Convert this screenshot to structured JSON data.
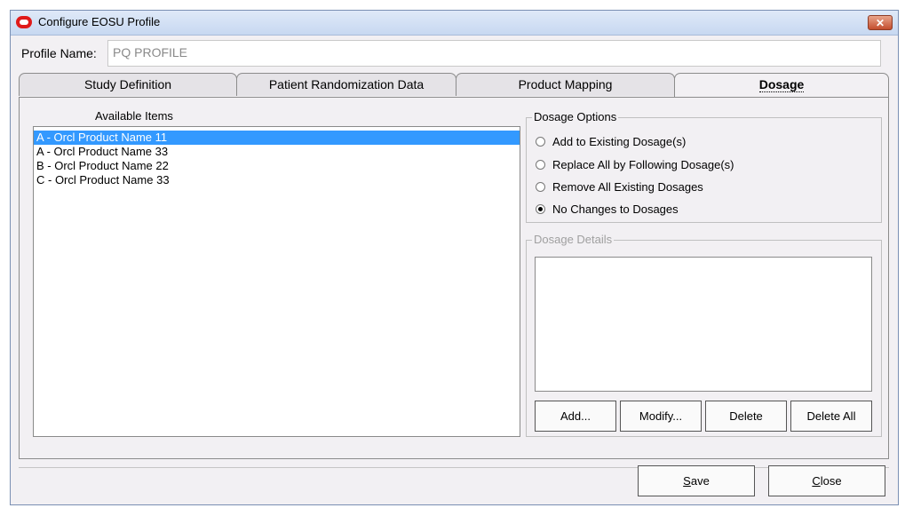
{
  "window": {
    "title": "Configure EOSU Profile",
    "close_label": "✕"
  },
  "profile": {
    "label": "Profile Name:",
    "value": "PQ PROFILE"
  },
  "tabs": [
    {
      "label": "Study Definition",
      "active": false
    },
    {
      "label": "Patient Randomization Data",
      "active": false
    },
    {
      "label": "Product Mapping",
      "active": false
    },
    {
      "label": "Dosage",
      "active": true
    }
  ],
  "available_items": {
    "label": "Available Items",
    "items": [
      {
        "text": "A - Orcl Product Name 11",
        "selected": true
      },
      {
        "text": "A - Orcl Product Name 33",
        "selected": false
      },
      {
        "text": "B - Orcl Product Name 22",
        "selected": false
      },
      {
        "text": "C - Orcl Product Name 33",
        "selected": false
      }
    ]
  },
  "dosage_options": {
    "legend": "Dosage Options",
    "options": [
      {
        "label": "Add to Existing Dosage(s)",
        "checked": false
      },
      {
        "label": "Replace All by Following Dosage(s)",
        "checked": false
      },
      {
        "label": "Remove All Existing Dosages",
        "checked": false
      },
      {
        "label": "No Changes to Dosages",
        "checked": true
      }
    ]
  },
  "dosage_details": {
    "legend": "Dosage Details",
    "buttons": {
      "add": "Add...",
      "modify": "Modify...",
      "delete": "Delete",
      "delete_all": "Delete All"
    }
  },
  "footer": {
    "save_mnemonic": "S",
    "save_rest": "ave",
    "close_mnemonic": "C",
    "close_rest": "lose"
  },
  "colors": {
    "selection": "#3399ff",
    "window_bg": "#f2f0f3",
    "titlebar": "#c7d8f1",
    "close_button": "#c34d2d"
  }
}
